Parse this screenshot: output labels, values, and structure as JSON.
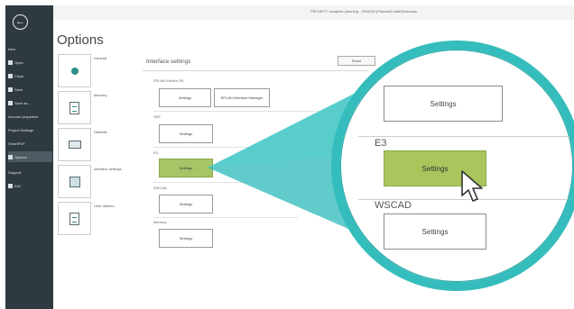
{
  "window": {
    "title": "PROJECT: complete planning - 2016/3/2 [Planwelt] mitte/Dokustan"
  },
  "sidebar": {
    "items": [
      {
        "label": "New"
      },
      {
        "label": "Open"
      },
      {
        "label": "Close"
      },
      {
        "label": "Save"
      },
      {
        "label": "Save as..."
      },
      {
        "label": "Account properties"
      },
      {
        "label": "Project Settings"
      },
      {
        "label": "SmartPDF"
      },
      {
        "label": "Options"
      },
      {
        "label": "Support"
      },
      {
        "label": "Exit"
      }
    ],
    "active_index": 8
  },
  "options": {
    "title": "Options",
    "nav": [
      {
        "label": "General",
        "icon": "gear-icon"
      },
      {
        "label": "Memory",
        "icon": "document-icon"
      },
      {
        "label": "Defaults",
        "icon": "keyboard-icon"
      },
      {
        "label": "Interface settings",
        "icon": "database-icon"
      },
      {
        "label": "User defines",
        "icon": "page-icon"
      }
    ]
  },
  "panel": {
    "title": "Interface settings",
    "reset_label": "Reset",
    "groups": [
      {
        "label": "EPLAN Electric P8",
        "buttons": [
          "Settings",
          "EPLAN Interface Manager"
        ]
      },
      {
        "label": "SEE",
        "buttons": [
          "Settings"
        ]
      },
      {
        "label": "E3",
        "buttons": [
          "Settings"
        ],
        "highlighted": true
      },
      {
        "label": "WSCAD",
        "buttons": [
          "Settings"
        ]
      },
      {
        "label": "Memory",
        "buttons": [
          "Settings"
        ]
      }
    ]
  },
  "magnifier": {
    "top_button": "Settings",
    "e3_label": "E3",
    "e3_button": "Settings",
    "wscad_label": "WSCAD",
    "wscad_button": "Settings"
  },
  "colors": {
    "sidebar": "#2e3a40",
    "accent_teal": "#35bdbd",
    "highlight_green": "#a9c55c"
  }
}
